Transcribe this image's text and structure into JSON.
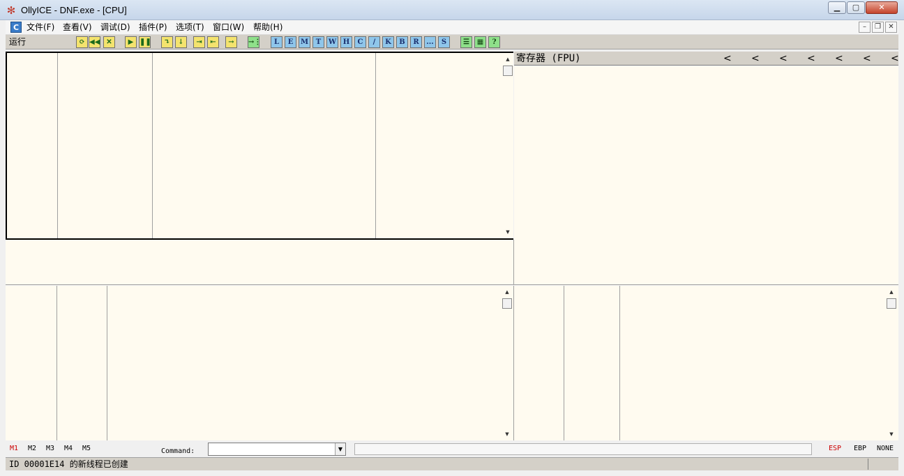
{
  "window": {
    "title": "OllyICE - DNF.exe - [CPU]",
    "minimize": "▁",
    "maximize": "▢",
    "close": "✕",
    "app_icon": "bug-icon"
  },
  "menu": {
    "logo": "C",
    "items": [
      "文件(F)",
      "查看(V)",
      "调试(D)",
      "插件(P)",
      "选项(T)",
      "窗口(W)",
      "帮助(H)"
    ],
    "mdi_min": "–",
    "mdi_restore": "❐",
    "mdi_close": "✕"
  },
  "toolbar": {
    "status": "运行",
    "buttons": [
      {
        "label": "⟳",
        "style": "yellow"
      },
      {
        "label": "◀◀",
        "style": "yellow"
      },
      {
        "label": "✕",
        "style": "yellow"
      },
      {
        "label": "▶",
        "style": "yellow"
      },
      {
        "label": "❚❚",
        "style": "yellow"
      },
      {
        "label": "↴",
        "style": "yellow"
      },
      {
        "label": "↓",
        "style": "yellow"
      },
      {
        "label": "⇥",
        "style": "yellow"
      },
      {
        "label": "⇤",
        "style": "yellow"
      },
      {
        "label": "→",
        "style": "yellow"
      },
      {
        "label": "→⋮",
        "style": "green"
      },
      {
        "label": "L",
        "style": "blue"
      },
      {
        "label": "E",
        "style": "blue"
      },
      {
        "label": "M",
        "style": "blue"
      },
      {
        "label": "T",
        "style": "blue"
      },
      {
        "label": "W",
        "style": "blue"
      },
      {
        "label": "H",
        "style": "blue"
      },
      {
        "label": "C",
        "style": "blue"
      },
      {
        "label": "/",
        "style": "blue"
      },
      {
        "label": "K",
        "style": "blue"
      },
      {
        "label": "B",
        "style": "blue"
      },
      {
        "label": "R",
        "style": "blue"
      },
      {
        "label": "...",
        "style": "blue"
      },
      {
        "label": "S",
        "style": "blue"
      },
      {
        "label": "☰",
        "style": "green"
      },
      {
        "label": "▦",
        "style": "green"
      },
      {
        "label": "?",
        "style": "green"
      }
    ]
  },
  "registers": {
    "title": "寄存器 (FPU)",
    "chevrons": [
      "<",
      "<",
      "<",
      "<",
      "<",
      "<",
      "<"
    ]
  },
  "bottom": {
    "tabs": [
      "M1",
      "M2",
      "M3",
      "M4",
      "M5"
    ],
    "active_tab_color": "#cc0000",
    "command_label": "Command:",
    "command_value": "",
    "dropdown": "▼",
    "stack_regs": [
      "ESP",
      "EBP",
      "NONE"
    ]
  },
  "status": {
    "text": "ID 00001E14 的新线程已创建"
  },
  "colors": {
    "pane_bg": "#fffbf0",
    "toolbar_bg": "#d4d0c8"
  }
}
